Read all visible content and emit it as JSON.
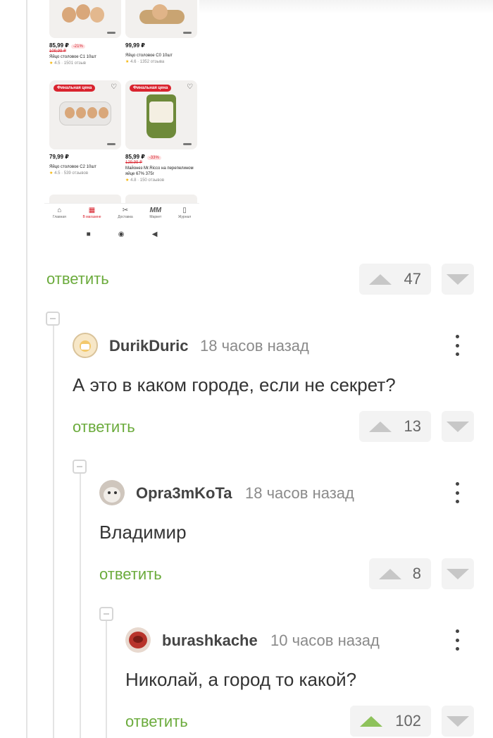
{
  "screenshot": {
    "products": [
      {
        "price": "85,99 ₽",
        "discount": "-21%",
        "old_price": "109,99 ₽",
        "name": "Яйцо столовое С1 10шт",
        "rating": "4.5 · 1501 отзыв",
        "badge": ""
      },
      {
        "price": "99,99 ₽",
        "discount": "",
        "old_price": "",
        "name": "Яйцо столовое С0 10шт",
        "rating": "4.6 · 1352 отзыва",
        "badge": ""
      },
      {
        "price": "79,99 ₽",
        "discount": "",
        "old_price": "",
        "name": "Яйцо столовое С2 10шт",
        "rating": "4.5 · 539 отзывов",
        "badge": "Финальная цена"
      },
      {
        "price": "85,99 ₽",
        "discount": "-33%",
        "old_price": "129,99 ₽",
        "name": "Майонез Mr.Ricco на перепелином яйце 67% 375г",
        "rating": "4.8 · 150 отзывов",
        "badge": "Финальная цена"
      }
    ],
    "nav": [
      {
        "label": "Главная",
        "icon": "⌂"
      },
      {
        "label": "В магазине",
        "icon": "▦"
      },
      {
        "label": "Доставка",
        "icon": "✂"
      },
      {
        "label": "Маркет",
        "icon": "MM"
      },
      {
        "label": "Журнал",
        "icon": "▯"
      }
    ]
  },
  "top_actions": {
    "reply_label": "ответить",
    "votes": "47"
  },
  "comments": [
    {
      "author": "DurikDuric",
      "time": "18 часов назад",
      "text": "А это в каком городе, если не секрет?",
      "reply_label": "ответить",
      "votes": "13"
    },
    {
      "author": "Opra3mKoTa",
      "time": "18 часов назад",
      "text": "Владимир",
      "reply_label": "ответить",
      "votes": "8"
    },
    {
      "author": "burashkache",
      "time": "10 часов назад",
      "text": "Николай, а город то какой?",
      "reply_label": "ответить",
      "votes": "102"
    }
  ],
  "colors": {
    "reply_green": "#6bab3c",
    "upvoted_green": "#8ec25b",
    "badge_red": "#d9232e"
  }
}
